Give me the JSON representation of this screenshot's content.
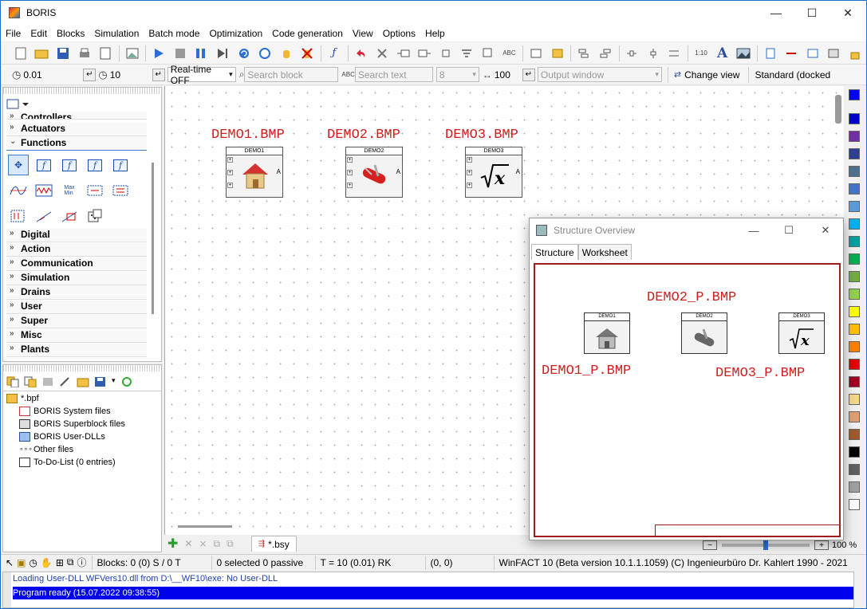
{
  "window": {
    "title": "BORIS",
    "min_glyph": "—",
    "max_glyph": "☐",
    "close_glyph": "✕"
  },
  "menu": [
    "File",
    "Edit",
    "Blocks",
    "Simulation",
    "Batch mode",
    "Optimization",
    "Code generation",
    "View",
    "Options",
    "Help"
  ],
  "toolbar2": {
    "step_value": "0.01",
    "end_value": "10",
    "realtime": "Real-time OFF",
    "search_block_placeholder": "Search block",
    "search_text_placeholder": "Search text",
    "font_size": "8",
    "width_value": "100",
    "output_window": "Output window",
    "change_view": "Change view",
    "docked_mode": "Standard (docked"
  },
  "left_panel": {
    "categories_top": [
      "Controllers",
      "Actuators",
      "Functions"
    ],
    "categories_bottom": [
      "Digital",
      "Action",
      "Communication",
      "Simulation",
      "Drains",
      "User",
      "Super",
      "Misc",
      "Plants"
    ]
  },
  "project_tree": {
    "root": "*.bpf",
    "items": [
      "BORIS System files",
      "BORIS Superblock files",
      "BORIS User-DLLs",
      "Other files",
      "To-Do-List (0 entries)"
    ]
  },
  "canvas": {
    "blocks": [
      {
        "label": "DEMO1.BMP",
        "title": "DEMO1",
        "icon": "house-icon"
      },
      {
        "label": "DEMO2.BMP",
        "title": "DEMO2",
        "icon": "swiss-knife-icon"
      },
      {
        "label": "DEMO3.BMP",
        "title": "DEMO3",
        "icon": "sqrt-x-icon"
      }
    ],
    "port_glyph": "+",
    "output_glyph": "A",
    "file_tab": "*.bsy"
  },
  "structure_overview": {
    "title": "Structure Overview",
    "tabs": [
      "Structure",
      "Worksheet"
    ],
    "labels": [
      "DEMO1_P.BMP",
      "DEMO2_P.BMP",
      "DEMO3_P.BMP"
    ],
    "block_titles": [
      "DEMO1",
      "DEMO2",
      "DEMO3"
    ]
  },
  "zoom": {
    "value": "100 %"
  },
  "status": {
    "blocks": "Blocks: 0 (0) S / 0 T",
    "selection": "0 selected  0 passive",
    "time": "T = 10  (0.01)  RK",
    "coords": "(0, 0)",
    "version": "WinFACT 10 (Beta version 10.1.1.1059)  (C) Ingenieurbüro Dr. Kahlert 1990 - 2021"
  },
  "output": {
    "line1": "Loading User-DLL WFVers10.dll from D:\\__WF10\\exe: No User-DLL",
    "line2": "Program ready    (15.07.2022 09:38:55)"
  },
  "palette_colors": [
    "#0000ff",
    "#0000cc",
    "#7030a0",
    "#2f3f8f",
    "#4f6f8f",
    "#4472c4",
    "#5b9bd5",
    "#00b0f0",
    "#00a0a0",
    "#00b050",
    "#70ad47",
    "#92d050",
    "#ffff00",
    "#ffc000",
    "#ff8000",
    "#e00000",
    "#a00020",
    "#f4d78a",
    "#e0a070",
    "#a05a2c",
    "#000000",
    "#606060",
    "#a0a0a0",
    "#ffffff"
  ]
}
